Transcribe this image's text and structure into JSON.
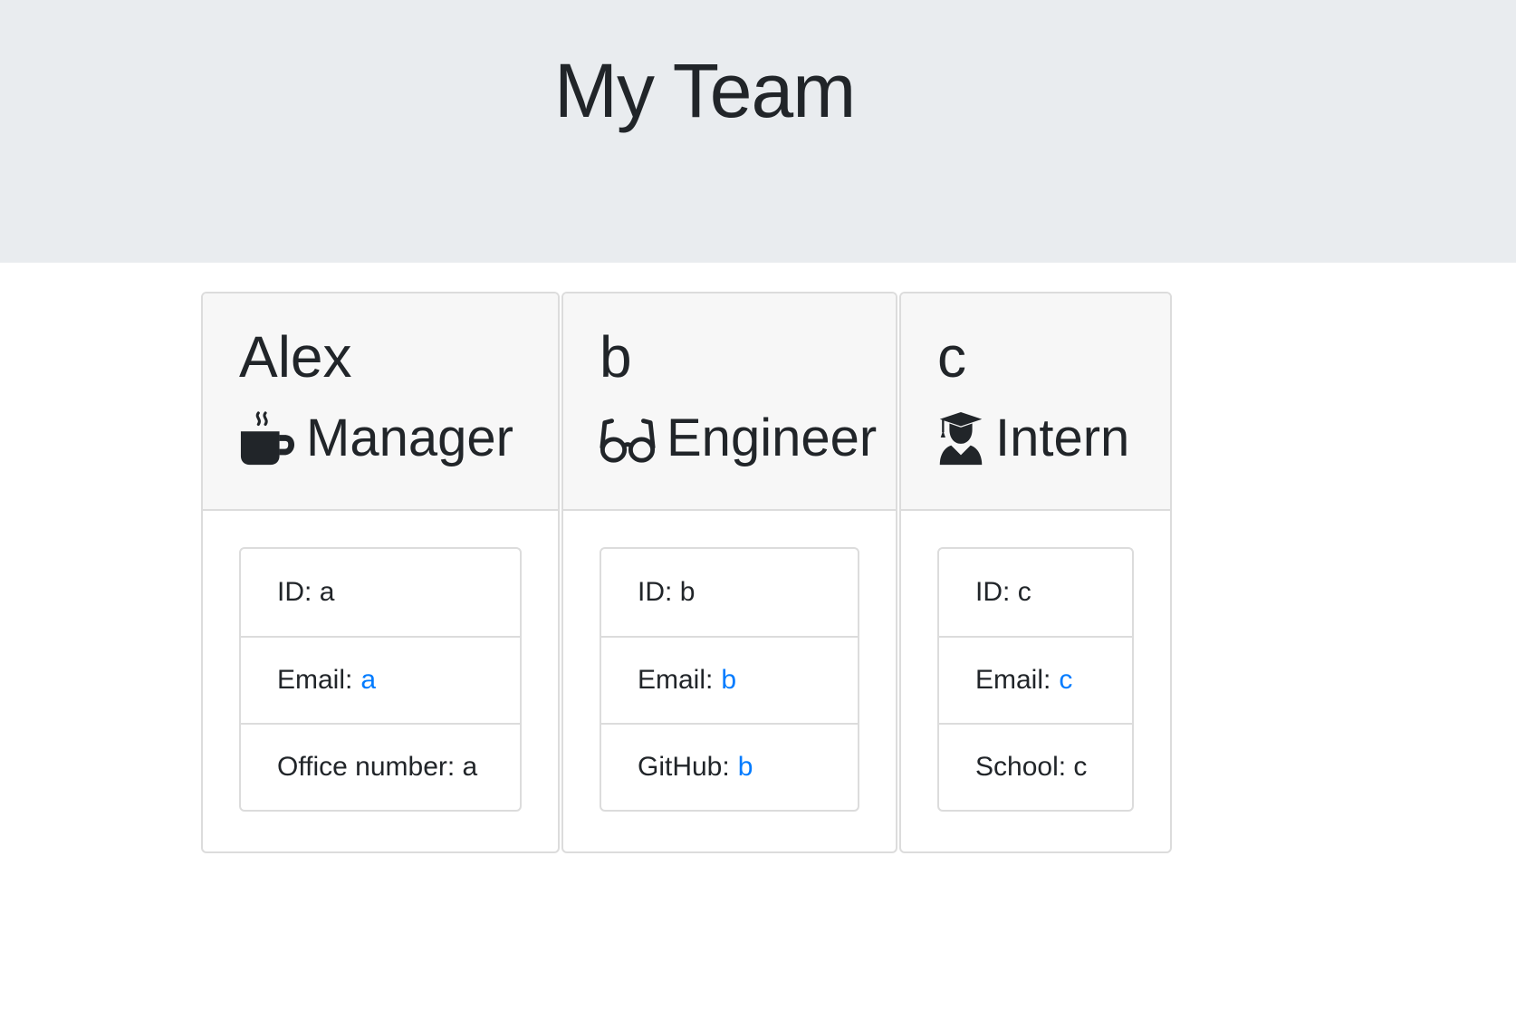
{
  "header": {
    "title": "My Team"
  },
  "cards": [
    {
      "name": "Alex",
      "role": "Manager",
      "icon": "mug-hot-icon",
      "items": [
        {
          "label": "ID:",
          "value": "a"
        },
        {
          "label": "Email:",
          "value": "a"
        },
        {
          "label": "Office number:",
          "value": "a"
        }
      ]
    },
    {
      "name": "b",
      "role": "Engineer",
      "icon": "glasses-icon",
      "items": [
        {
          "label": "ID:",
          "value": "b"
        },
        {
          "label": "Email:",
          "value": "b"
        },
        {
          "label": "GitHub:",
          "value": "b"
        }
      ]
    },
    {
      "name": "c",
      "role": "Intern",
      "icon": "user-graduate-icon",
      "items": [
        {
          "label": "ID:",
          "value": "c"
        },
        {
          "label": "Email:",
          "value": "c"
        },
        {
          "label": "School:",
          "value": "c"
        }
      ]
    }
  ],
  "colors": {
    "jumbotron_bg": "#e9ecef",
    "card_header_bg": "#f7f7f7",
    "link": "#007bff",
    "text": "#212529",
    "border": "#dcdcdc"
  }
}
